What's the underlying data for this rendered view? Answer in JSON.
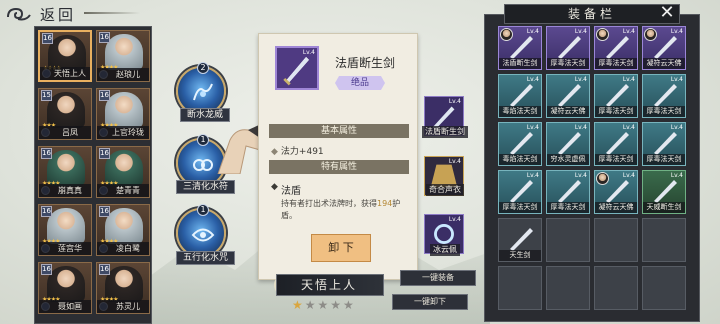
{
  "header": {
    "back_label": "返回"
  },
  "characters": [
    {
      "name": "天悟上人",
      "level": "16",
      "stars": "★★★★",
      "selected": true
    },
    {
      "name": "赵琅儿",
      "level": "16",
      "stars": "★★★★",
      "selected": false
    },
    {
      "name": "吕凤",
      "level": "15",
      "stars": "★★★",
      "selected": false
    },
    {
      "name": "上官玲珑",
      "level": "16",
      "stars": "★★★★",
      "selected": false
    },
    {
      "name": "崩真真",
      "level": "16",
      "stars": "★★★★",
      "selected": false
    },
    {
      "name": "楚青青",
      "level": "16",
      "stars": "★★★★",
      "selected": false
    },
    {
      "name": "莲宫华",
      "level": "16",
      "stars": "★★★★",
      "selected": false
    },
    {
      "name": "凌白鹭",
      "level": "16",
      "stars": "★★★★",
      "selected": false
    },
    {
      "name": "聂如画",
      "level": "16",
      "stars": "★★★★",
      "selected": false
    },
    {
      "name": "苏灵儿",
      "level": "16",
      "stars": "★★★★",
      "selected": false
    }
  ],
  "skills": [
    {
      "label": "断水龙威",
      "badge": "2"
    },
    {
      "label": "三清化水符",
      "badge": "1"
    },
    {
      "label": "五行化水咒",
      "badge": "1"
    }
  ],
  "tooltip": {
    "item_name": "法盾断生剑",
    "level": "Lv.4",
    "rarity": "绝品",
    "basic_section": "基本属性",
    "basic_attr": "法力+491",
    "special_section": "特有属性",
    "skill_name": "法盾",
    "desc_prefix": "持有者打出术法牌时，获得",
    "desc_value": "194",
    "desc_suffix": "护盾。",
    "unequip_label": "卸 下"
  },
  "hero": {
    "name": "天悟上人",
    "stars_filled": "★",
    "stars_empty": "★★★★"
  },
  "equipped": [
    {
      "label": "法盾断生剑",
      "level": "Lv.4"
    },
    {
      "label": "奇合声衣",
      "level": "Lv.4"
    },
    {
      "label": "冰云佩",
      "level": "Lv.4"
    }
  ],
  "actions": {
    "equip_all": "一键装备",
    "unequip_all": "一键卸下"
  },
  "equip_panel": {
    "title": "装备栏",
    "items": [
      {
        "label": "法盾断生剑",
        "level": "Lv.4",
        "rarity": "purple",
        "owned": true
      },
      {
        "label": "厚毒法天剑",
        "level": "Lv.4",
        "rarity": "purple",
        "owned": false
      },
      {
        "label": "厚毒法天剑",
        "level": "Lv.4",
        "rarity": "purple",
        "owned": true
      },
      {
        "label": "凝符云天佛",
        "level": "Lv.4",
        "rarity": "purple",
        "owned": true
      },
      {
        "label": "毒焰法天剑",
        "level": "Lv.4",
        "rarity": "teal",
        "owned": false
      },
      {
        "label": "凝符云天佛",
        "level": "Lv.4",
        "rarity": "teal",
        "owned": false
      },
      {
        "label": "厚毒法天剑",
        "level": "Lv.4",
        "rarity": "teal",
        "owned": false
      },
      {
        "label": "厚毒法天剑",
        "level": "Lv.4",
        "rarity": "teal",
        "owned": false
      },
      {
        "label": "毒焰法天剑",
        "level": "Lv.4",
        "rarity": "teal",
        "owned": false
      },
      {
        "label": "穷水灵虚佩",
        "level": "Lv.4",
        "rarity": "teal",
        "owned": false
      },
      {
        "label": "厚毒法天剑",
        "level": "Lv.4",
        "rarity": "teal",
        "owned": false
      },
      {
        "label": "厚毒法天剑",
        "level": "Lv.4",
        "rarity": "teal",
        "owned": false
      },
      {
        "label": "厚毒法天剑",
        "level": "Lv.4",
        "rarity": "teal",
        "owned": false
      },
      {
        "label": "厚毒法天剑",
        "level": "Lv.4",
        "rarity": "teal",
        "owned": false
      },
      {
        "label": "凝符云天佛",
        "level": "Lv.4",
        "rarity": "teal",
        "owned": true
      },
      {
        "label": "天威断生剑",
        "level": "Lv.4",
        "rarity": "green",
        "owned": false
      },
      {
        "label": "天生剑",
        "level": "",
        "rarity": "empty",
        "owned": false
      },
      {
        "label": "",
        "level": "",
        "rarity": "empty",
        "owned": false
      },
      {
        "label": "",
        "level": "",
        "rarity": "empty",
        "owned": false
      },
      {
        "label": "",
        "level": "",
        "rarity": "empty",
        "owned": false
      },
      {
        "label": "",
        "level": "",
        "rarity": "empty",
        "owned": false
      },
      {
        "label": "",
        "level": "",
        "rarity": "empty",
        "owned": false
      },
      {
        "label": "",
        "level": "",
        "rarity": "empty",
        "owned": false
      },
      {
        "label": "",
        "level": "",
        "rarity": "empty",
        "owned": false
      }
    ]
  }
}
